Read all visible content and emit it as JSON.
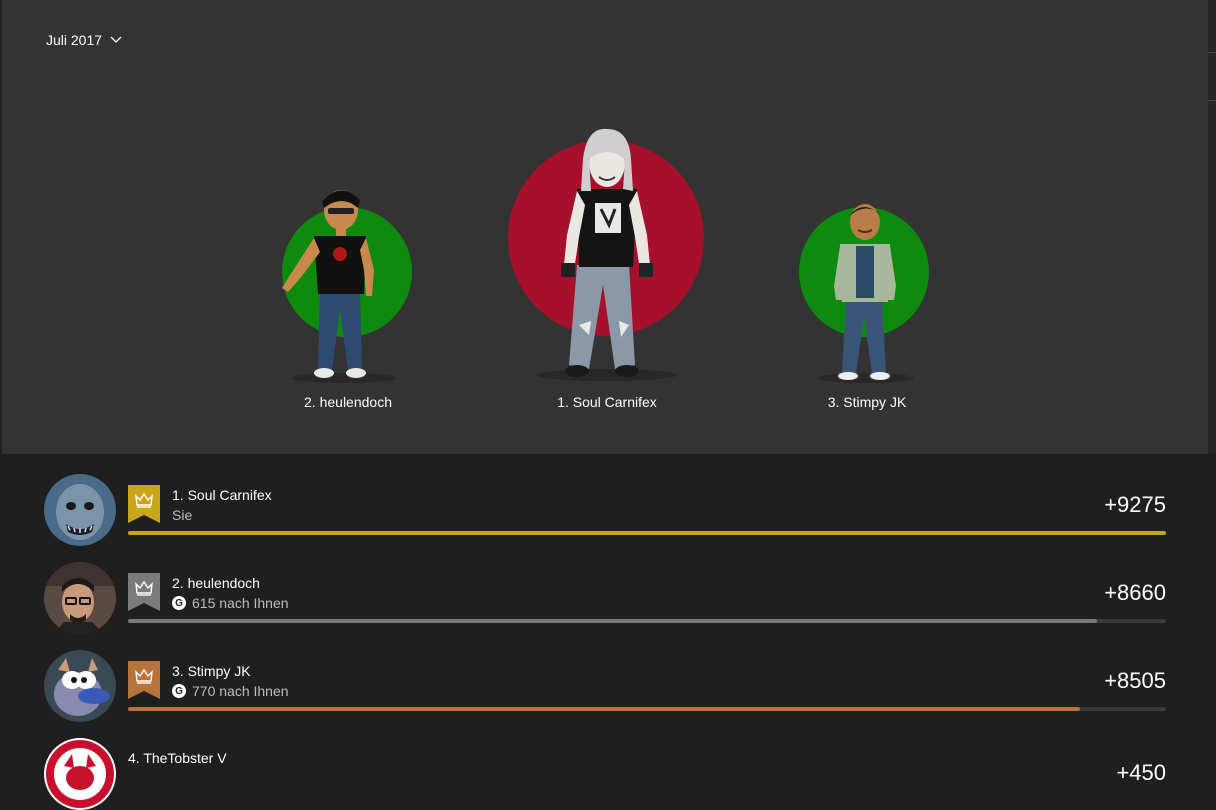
{
  "header": {
    "month_label": "Juli 2017"
  },
  "podium": {
    "first": {
      "label": "1. Soul Carnifex",
      "circle_color": "#a6102b"
    },
    "second": {
      "label": "2. heulendoch",
      "circle_color": "#0e8a0e"
    },
    "third": {
      "label": "3. Stimpy JK",
      "circle_color": "#0e8a0e"
    }
  },
  "leaderboard": {
    "rows": [
      {
        "name": "1. Soul Carnifex",
        "sub": "Sie",
        "score": "+9275",
        "progress": 1.0,
        "badge_color": "#c9a51a",
        "bar_color": "#c9a51a"
      },
      {
        "name": "2. heulendoch",
        "sub": "615 nach Ihnen",
        "score": "+8660",
        "progress": 0.934,
        "badge_color": "#7a7a7a",
        "bar_color": "#7a7a7a"
      },
      {
        "name": "3. Stimpy JK",
        "sub": "770 nach Ihnen",
        "score": "+8505",
        "progress": 0.917,
        "badge_color": "#b8733a",
        "bar_color": "#b8733a"
      },
      {
        "name": "4. TheTobster V",
        "score": "+450"
      }
    ],
    "gamerscore_icon": "G"
  }
}
